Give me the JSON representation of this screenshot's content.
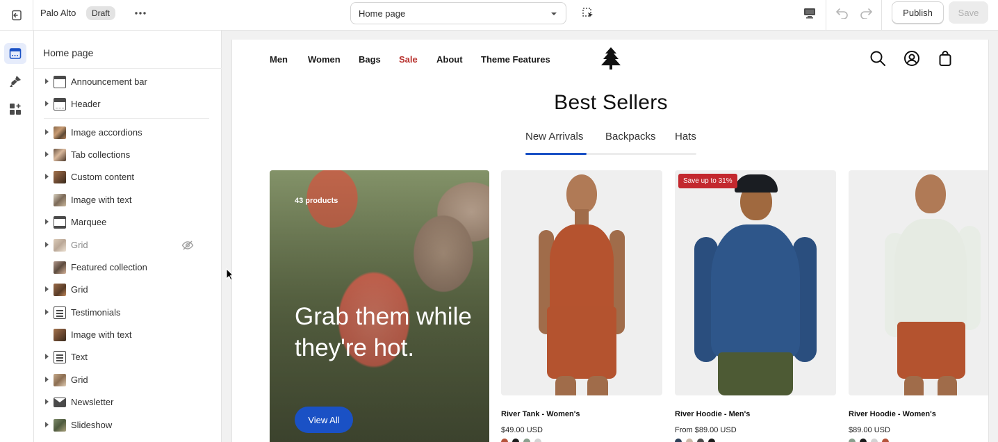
{
  "topbar": {
    "store_name": "Palo Alto",
    "status_badge": "Draft",
    "page_selector": "Home page",
    "publish_label": "Publish",
    "save_label": "Save"
  },
  "sidebar": {
    "title": "Home page",
    "items": [
      {
        "label": "Announcement bar",
        "icon": "announcement-bar-icon",
        "expandable": true
      },
      {
        "label": "Header",
        "icon": "header-layout-icon",
        "expandable": true
      },
      {
        "label": "Image accordions",
        "icon": "image-thumbnail-icon",
        "expandable": true
      },
      {
        "label": "Tab collections",
        "icon": "image-thumbnail-icon",
        "expandable": true
      },
      {
        "label": "Custom content",
        "icon": "image-thumbnail-icon",
        "expandable": true
      },
      {
        "label": "Image with text",
        "icon": "image-thumbnail-icon",
        "expandable": false
      },
      {
        "label": "Marquee",
        "icon": "marquee-icon",
        "expandable": true
      },
      {
        "label": "Grid",
        "icon": "image-thumbnail-icon",
        "expandable": true,
        "hidden": true
      },
      {
        "label": "Featured collection",
        "icon": "image-thumbnail-icon",
        "expandable": false
      },
      {
        "label": "Grid",
        "icon": "image-thumbnail-icon",
        "expandable": true
      },
      {
        "label": "Testimonials",
        "icon": "text-block-icon",
        "expandable": true
      },
      {
        "label": "Image with text",
        "icon": "image-thumbnail-icon",
        "expandable": false
      },
      {
        "label": "Text",
        "icon": "text-block-icon",
        "expandable": true
      },
      {
        "label": "Grid",
        "icon": "image-thumbnail-icon",
        "expandable": true
      },
      {
        "label": "Newsletter",
        "icon": "mail-icon",
        "expandable": true
      },
      {
        "label": "Slideshow",
        "icon": "image-thumbnail-icon",
        "expandable": true
      }
    ]
  },
  "preview": {
    "nav": [
      "Men",
      "Women",
      "Bags",
      "Sale",
      "About",
      "Theme Features"
    ],
    "heading": "Best Sellers",
    "tabs": [
      "New Arrivals",
      "Backpacks",
      "Hats"
    ],
    "promo": {
      "count": "43 products",
      "headline": "Grab them while they're hot.",
      "button": "View All"
    },
    "products": [
      {
        "name": "River Tank - Women's",
        "price": "$49.00 USD",
        "badge": "",
        "swatches": [
          "#b5533a",
          "#1c1c1c",
          "#8aa08e",
          "#d3d3d3"
        ]
      },
      {
        "name": "River Hoodie - Men's",
        "price": "From $89.00 USD",
        "badge": "Save up to 31%",
        "swatches": [
          "#2c3f57",
          "#c9b8a8",
          "#4a4a4a",
          "#1c1c1c"
        ]
      },
      {
        "name": "River Hoodie - Women's",
        "price": "$89.00 USD",
        "badge": "",
        "swatches": [
          "#8aa08e",
          "#1c1c1c",
          "#d3d3d3",
          "#b5533a"
        ]
      }
    ]
  },
  "colors": {
    "accent": "#1a51c5",
    "sale": "#b8322e",
    "badge": "#c3282e"
  }
}
